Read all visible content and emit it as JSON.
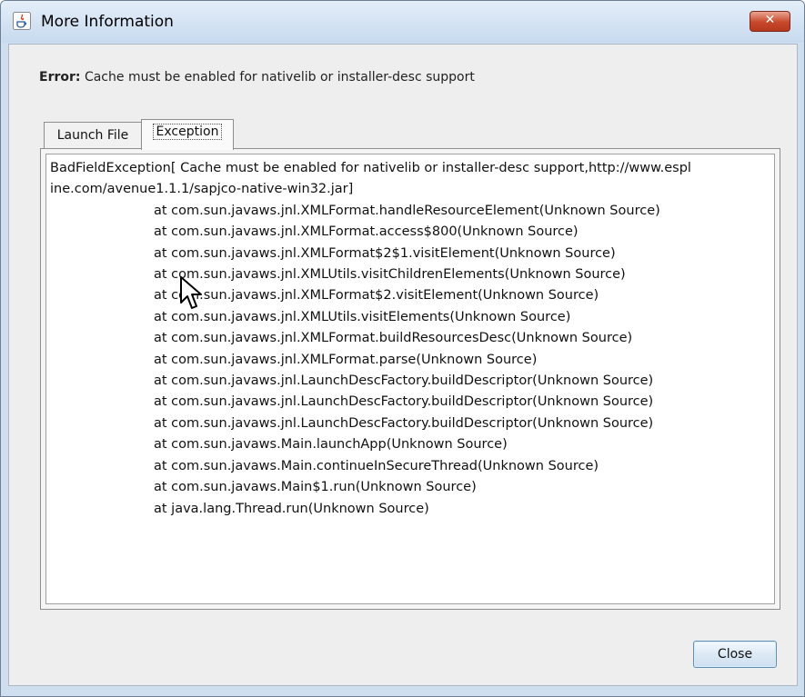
{
  "window": {
    "title": "More Information",
    "close_icon": "close-icon",
    "app_icon": "java-icon"
  },
  "error": {
    "label": "Error:",
    "message": "Cache must be enabled for nativelib or installer-desc support"
  },
  "tabs": [
    {
      "label": "Launch File",
      "selected": false
    },
    {
      "label": "Exception",
      "selected": true
    }
  ],
  "exception": {
    "header_lines": [
      "BadFieldException[ Cache must be enabled for nativelib or installer-desc support,http://www.espl",
      "ine.com/avenue1.1.1/sapjco-native-win32.jar]"
    ],
    "stack": [
      "at com.sun.javaws.jnl.XMLFormat.handleResourceElement(Unknown Source)",
      "at com.sun.javaws.jnl.XMLFormat.access$800(Unknown Source)",
      "at com.sun.javaws.jnl.XMLFormat$2$1.visitElement(Unknown Source)",
      "at com.sun.javaws.jnl.XMLUtils.visitChildrenElements(Unknown Source)",
      "at com.sun.javaws.jnl.XMLFormat$2.visitElement(Unknown Source)",
      "at com.sun.javaws.jnl.XMLUtils.visitElements(Unknown Source)",
      "at com.sun.javaws.jnl.XMLFormat.buildResourcesDesc(Unknown Source)",
      "at com.sun.javaws.jnl.XMLFormat.parse(Unknown Source)",
      "at com.sun.javaws.jnl.LaunchDescFactory.buildDescriptor(Unknown Source)",
      "at com.sun.javaws.jnl.LaunchDescFactory.buildDescriptor(Unknown Source)",
      "at com.sun.javaws.jnl.LaunchDescFactory.buildDescriptor(Unknown Source)",
      "at com.sun.javaws.Main.launchApp(Unknown Source)",
      "at com.sun.javaws.Main.continueInSecureThread(Unknown Source)",
      "at com.sun.javaws.Main$1.run(Unknown Source)",
      "at java.lang.Thread.run(Unknown Source)"
    ]
  },
  "buttons": {
    "close_label": "Close"
  },
  "colors": {
    "title_bar": "#c7daef",
    "close_button": "#c7472a",
    "dialog_bg": "#eeeeee"
  }
}
